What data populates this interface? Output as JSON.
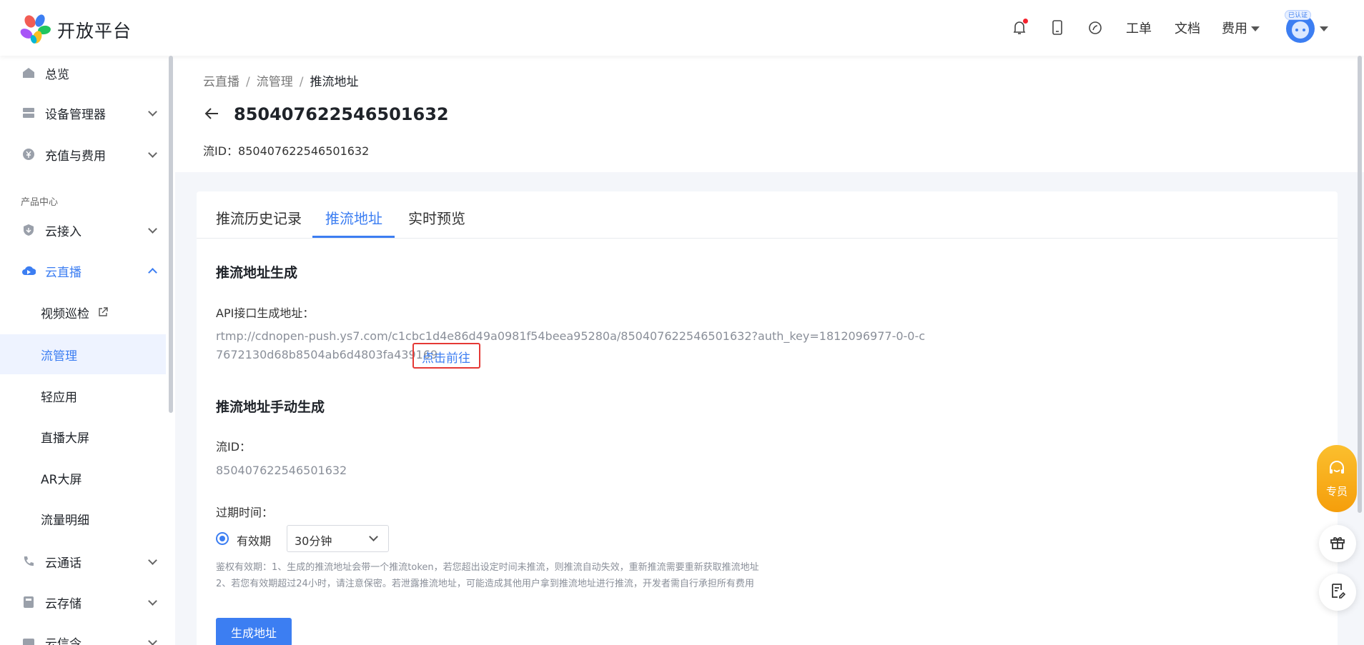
{
  "header": {
    "brand": "开放平台",
    "links": {
      "ticket": "工单",
      "docs": "文档",
      "fees": "费用"
    },
    "avatar_badge": "已认证",
    "icons": [
      "bell-icon",
      "mobile-icon",
      "weibo-icon"
    ]
  },
  "sidebar": {
    "section_label": "产品中心",
    "items": [
      {
        "label": "总览",
        "icon": "home-icon"
      },
      {
        "label": "设备管理器",
        "icon": "server-icon"
      },
      {
        "label": "充值与费用",
        "icon": "yuan-icon"
      },
      {
        "label": "云接入",
        "icon": "shield-down-icon"
      },
      {
        "label": "云直播",
        "icon": "cloud-play-icon"
      },
      {
        "label": "视频巡检",
        "icon": "external-link-icon"
      },
      {
        "label": "流管理"
      },
      {
        "label": "轻应用"
      },
      {
        "label": "直播大屏"
      },
      {
        "label": "AR大屏"
      },
      {
        "label": "流量明细"
      },
      {
        "label": "云通话",
        "icon": "phone-icon"
      },
      {
        "label": "云存储",
        "icon": "storage-icon"
      },
      {
        "label": "云信令",
        "icon": "signal-icon"
      }
    ]
  },
  "breadcrumb": {
    "l1": "云直播",
    "l2": "流管理",
    "current": "推流地址",
    "sep": "/"
  },
  "page": {
    "title": "850407622546501632",
    "stream_id_label": "流ID：",
    "stream_id": "850407622546501632"
  },
  "tabs": {
    "t1": "推流历史记录",
    "t2": "推流地址",
    "t3": "实时预览"
  },
  "gen": {
    "heading": "推流地址生成",
    "api_label": "API接口生成地址：",
    "url_line1": "rtmp://cdnopen-push.ys7.com/c1cbc1d4e86d49a0981f54beea95280a/850407622546501632?auth_key=1812096977-0-0-c",
    "url_line2": "7672130d68b8504ab6d4803fa439169",
    "go_link": "点击前往"
  },
  "manual": {
    "heading": "推流地址手动生成",
    "id_label": "流ID：",
    "id_value": "850407622546501632",
    "expire_label": "过期时间：",
    "radio_label": "有效期",
    "select_value": "30分钟",
    "note1": "鉴权有效期：1、生成的推流地址会带一个推流token，若您超出设定时间未推流，则推流自动失效，重新推流需要重新获取推流地址",
    "note2": "2、若您有效期超过24小时，请注意保密。若泄露推流地址，可能造成其他用户拿到推流地址进行推流，开发者需自行承担所有费用",
    "button": "生成地址"
  },
  "float": {
    "agent_label": "专员"
  },
  "colors": {
    "accent": "#3c7ef2",
    "highlight": "#e53935",
    "agent": "#f59e0b"
  }
}
